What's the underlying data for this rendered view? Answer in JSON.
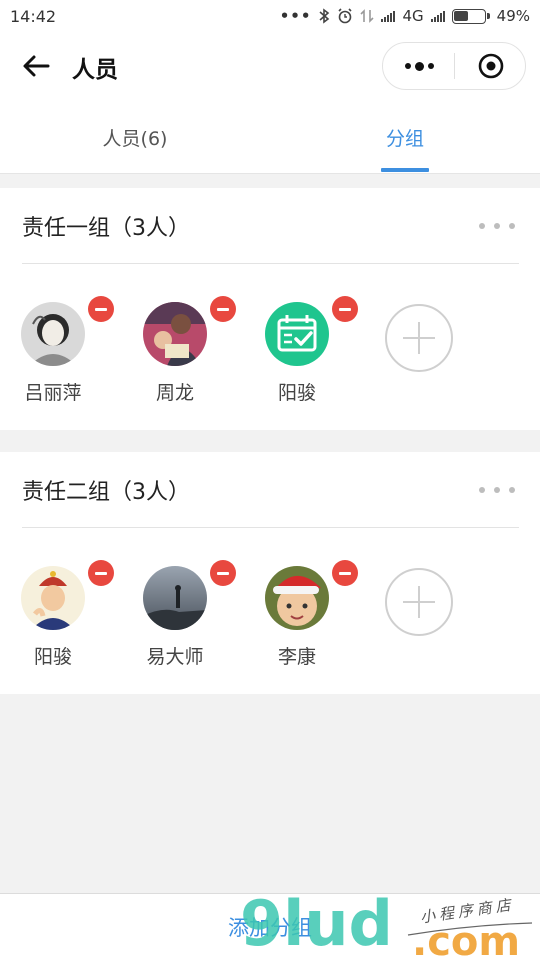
{
  "status_bar": {
    "time": "14:42",
    "network": "4G",
    "battery": "49%"
  },
  "navbar": {
    "title": "人员"
  },
  "tabs": [
    {
      "label": "人员(6)",
      "active": false
    },
    {
      "label": "分组",
      "active": true
    }
  ],
  "groups": [
    {
      "title": "责任一组（3人）",
      "members": [
        {
          "name": "吕丽萍",
          "avatar": "photo-girl"
        },
        {
          "name": "周龙",
          "avatar": "photo-man-reading"
        },
        {
          "name": "阳骏",
          "avatar": "calendar-check-icon"
        }
      ]
    },
    {
      "title": "责任二组（3人）",
      "members": [
        {
          "name": "阳骏",
          "avatar": "cartoon-portrait"
        },
        {
          "name": "易大师",
          "avatar": "photo-silhouette"
        },
        {
          "name": "李康",
          "avatar": "photo-baby-santa-hat"
        }
      ]
    }
  ],
  "footer": {
    "add_group_label": "添加分组"
  },
  "watermark": {
    "brand": "9lud",
    "suffix": ".com",
    "tagline": "小程序商店"
  },
  "colors": {
    "accent": "#3d8fe0",
    "remove": "#e8483f",
    "calendar_icon_bg": "#1fc58e"
  }
}
